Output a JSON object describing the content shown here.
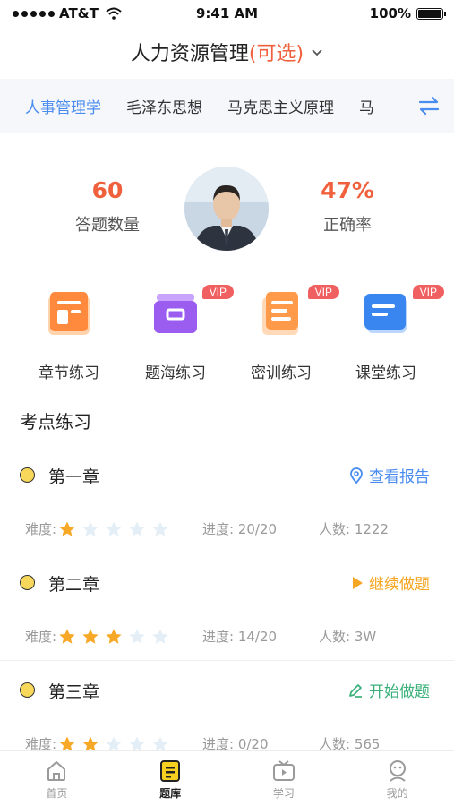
{
  "status_bar": {
    "carrier": "AT&T",
    "time": "9:41 AM",
    "battery": "100%"
  },
  "header": {
    "title": "人力资源管理",
    "optional": "(可选)"
  },
  "subjects": [
    "人事管理学",
    "毛泽东思想",
    "马克思主义原理",
    "马"
  ],
  "stats": {
    "answered_count": "60",
    "answered_label": "答题数量",
    "accuracy": "47%",
    "accuracy_label": "正确率"
  },
  "features": [
    {
      "name": "章节练习",
      "icon": "chapter-practice-icon",
      "color": "#ff8a3d",
      "vip": ""
    },
    {
      "name": "题海练习",
      "icon": "question-sea-icon",
      "color": "#9b5cf0",
      "vip": "VIP"
    },
    {
      "name": "密训练习",
      "icon": "intensive-training-icon",
      "color": "#ff9a4a",
      "vip": "VIP"
    },
    {
      "name": "课堂练习",
      "icon": "classroom-practice-icon",
      "color": "#3a86f0",
      "vip": "VIP"
    }
  ],
  "section_title": "考点练习",
  "chapters": [
    {
      "name": "第一章",
      "action": "查看报告",
      "action_icon": "location-icon",
      "action_color": "#4a8cf0",
      "difficulty_label": "难度:",
      "difficulty": 1,
      "progress": "进度: 20/20",
      "people": "人数: 1222"
    },
    {
      "name": "第二章",
      "action": "继续做题",
      "action_icon": "play-icon",
      "action_color": "#f5a623",
      "difficulty_label": "难度:",
      "difficulty": 3,
      "progress": "进度: 14/20",
      "people": "人数: 3W"
    },
    {
      "name": "第三章",
      "action": "开始做题",
      "action_icon": "pencil-icon",
      "action_color": "#3bb07a",
      "difficulty_label": "难度:",
      "difficulty": 2,
      "progress": "进度: 0/20",
      "people": "人数: 565"
    }
  ],
  "tabs": [
    {
      "label": "首页",
      "icon": "home-icon"
    },
    {
      "label": "题库",
      "icon": "question-bank-icon"
    },
    {
      "label": "学习",
      "icon": "tv-icon"
    },
    {
      "label": "我的",
      "icon": "profile-icon"
    }
  ],
  "active_tab": 1
}
